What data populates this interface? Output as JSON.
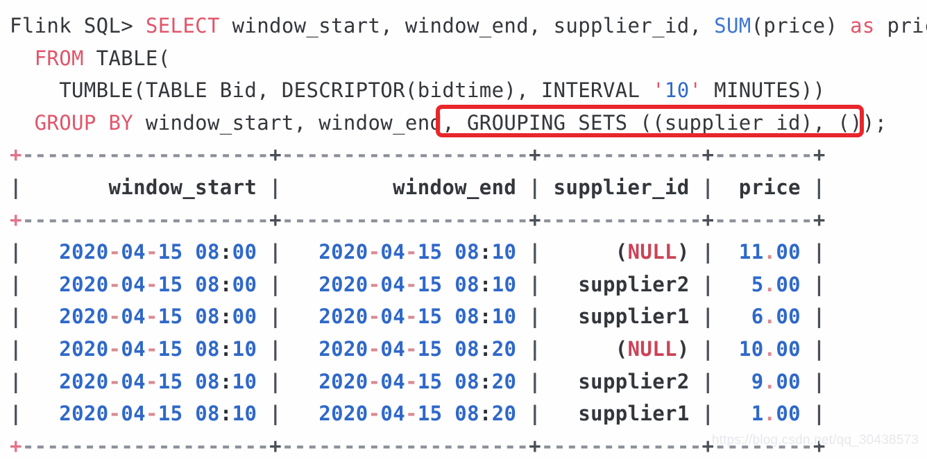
{
  "terminal": {
    "prompt": "Flink SQL> ",
    "query_lines": [
      {
        "indent": "",
        "tokens": [
          {
            "t": "Flink SQL> ",
            "c": "plain"
          },
          {
            "t": "SELECT",
            "c": "kw"
          },
          {
            "t": " window_start, window_end, supplier_id, ",
            "c": "plain"
          },
          {
            "t": "SUM",
            "c": "fn"
          },
          {
            "t": "(price) ",
            "c": "plain"
          },
          {
            "t": "as",
            "c": "kw"
          },
          {
            "t": " price",
            "c": "plain"
          }
        ]
      },
      {
        "indent": "  ",
        "tokens": [
          {
            "t": "FROM",
            "c": "kw"
          },
          {
            "t": " TABLE(",
            "c": "plain"
          }
        ]
      },
      {
        "indent": "    ",
        "tokens": [
          {
            "t": "TUMBLE(TABLE Bid, DESCRIPTOR(bidtime), INTERVAL ",
            "c": "plain"
          },
          {
            "t": "'",
            "c": "str-q"
          },
          {
            "t": "10",
            "c": "str-n"
          },
          {
            "t": "'",
            "c": "str-q"
          },
          {
            "t": " MINUTES))",
            "c": "plain"
          }
        ]
      },
      {
        "indent": "  ",
        "tokens": [
          {
            "t": "GROUP BY",
            "c": "kw"
          },
          {
            "t": " window_start, window_end, GROUPING SETS ((supplier_id), ());",
            "c": "plain"
          }
        ]
      }
    ],
    "highlighted_fragment": "GROUPING SETS ((supplier_id), ());",
    "separator": "+--------------------+--------------------+-------------+--------+",
    "columns": [
      {
        "label": "window_start",
        "width": 20
      },
      {
        "label": "window_end",
        "width": 20
      },
      {
        "label": "supplier_id",
        "width": 13
      },
      {
        "label": "price",
        "width": 8
      }
    ],
    "rows": [
      {
        "window_start": "2020-04-15 08:00",
        "window_end": "2020-04-15 08:10",
        "supplier_id": "(NULL)",
        "price": "11.00",
        "is_null": true
      },
      {
        "window_start": "2020-04-15 08:00",
        "window_end": "2020-04-15 08:10",
        "supplier_id": "supplier2",
        "price": "5.00",
        "is_null": false
      },
      {
        "window_start": "2020-04-15 08:00",
        "window_end": "2020-04-15 08:10",
        "supplier_id": "supplier1",
        "price": "6.00",
        "is_null": false
      },
      {
        "window_start": "2020-04-15 08:10",
        "window_end": "2020-04-15 08:20",
        "supplier_id": "(NULL)",
        "price": "10.00",
        "is_null": true
      },
      {
        "window_start": "2020-04-15 08:10",
        "window_end": "2020-04-15 08:20",
        "supplier_id": "supplier2",
        "price": "9.00",
        "is_null": false
      },
      {
        "window_start": "2020-04-15 08:10",
        "window_end": "2020-04-15 08:20",
        "supplier_id": "supplier1",
        "price": "1.00",
        "is_null": false
      }
    ]
  },
  "watermark": {
    "text": "https://blog.csdn.net/qq_30438573"
  },
  "colors": {
    "keyword": "#e2556b",
    "function": "#3f76d4",
    "value_blue": "#2f68c9",
    "null_red": "#cc4257",
    "annotation_box": "#e8262b",
    "text": "#33363b",
    "background": "#fefefe"
  }
}
